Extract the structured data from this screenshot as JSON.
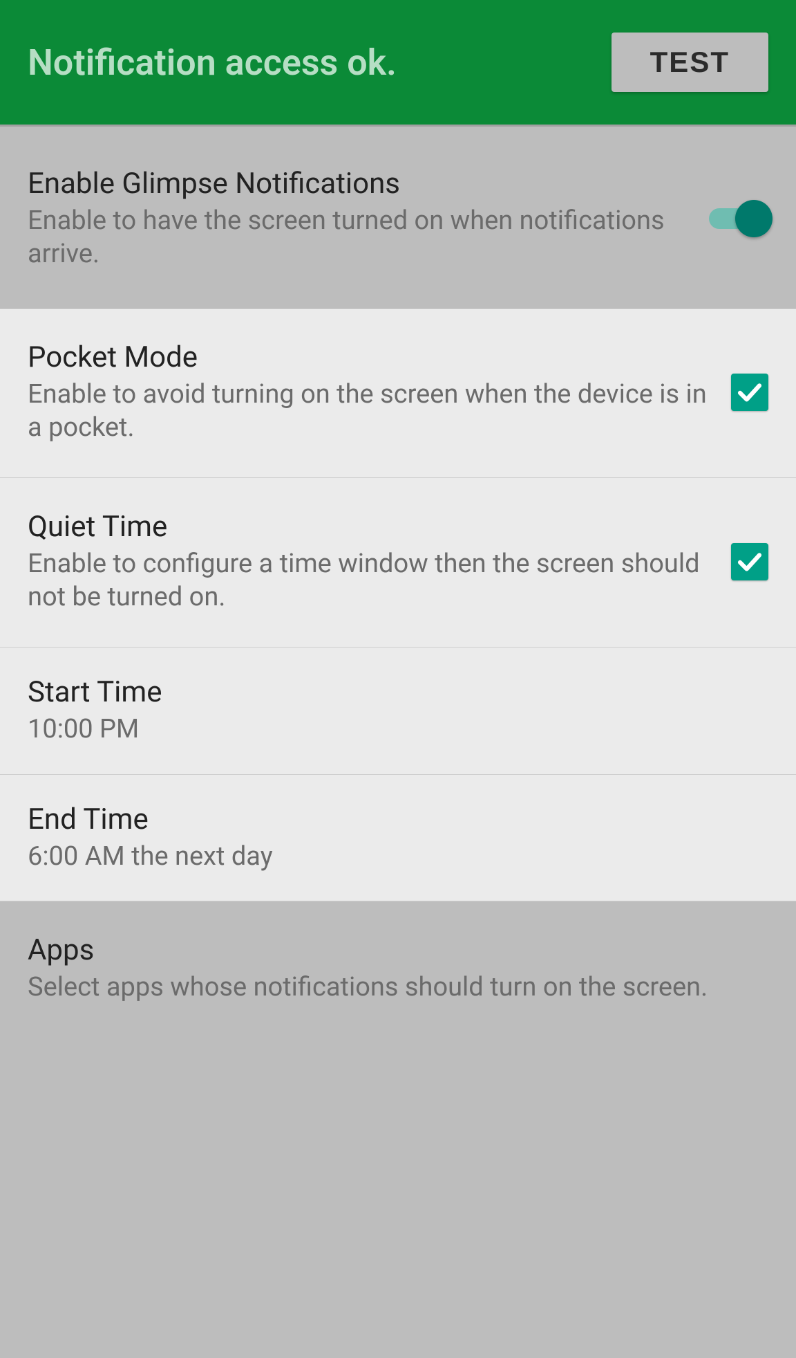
{
  "header": {
    "title": "Notification access ok.",
    "test_label": "TEST"
  },
  "rows": {
    "enable": {
      "title": "Enable Glimpse Notifications",
      "subtitle": "Enable to have the screen turned on when notifications arrive."
    },
    "pocket": {
      "title": "Pocket Mode",
      "subtitle": "Enable to avoid turning on the screen when the device is in a pocket."
    },
    "quiet": {
      "title": "Quiet Time",
      "subtitle": "Enable to configure a time window then the screen should not be turned on."
    },
    "start": {
      "title": "Start Time",
      "subtitle": "10:00 PM"
    },
    "end": {
      "title": "End Time",
      "subtitle": "6:00 AM the next day"
    },
    "apps": {
      "title": "Apps",
      "subtitle": "Select apps whose notifications should turn on the screen."
    }
  }
}
